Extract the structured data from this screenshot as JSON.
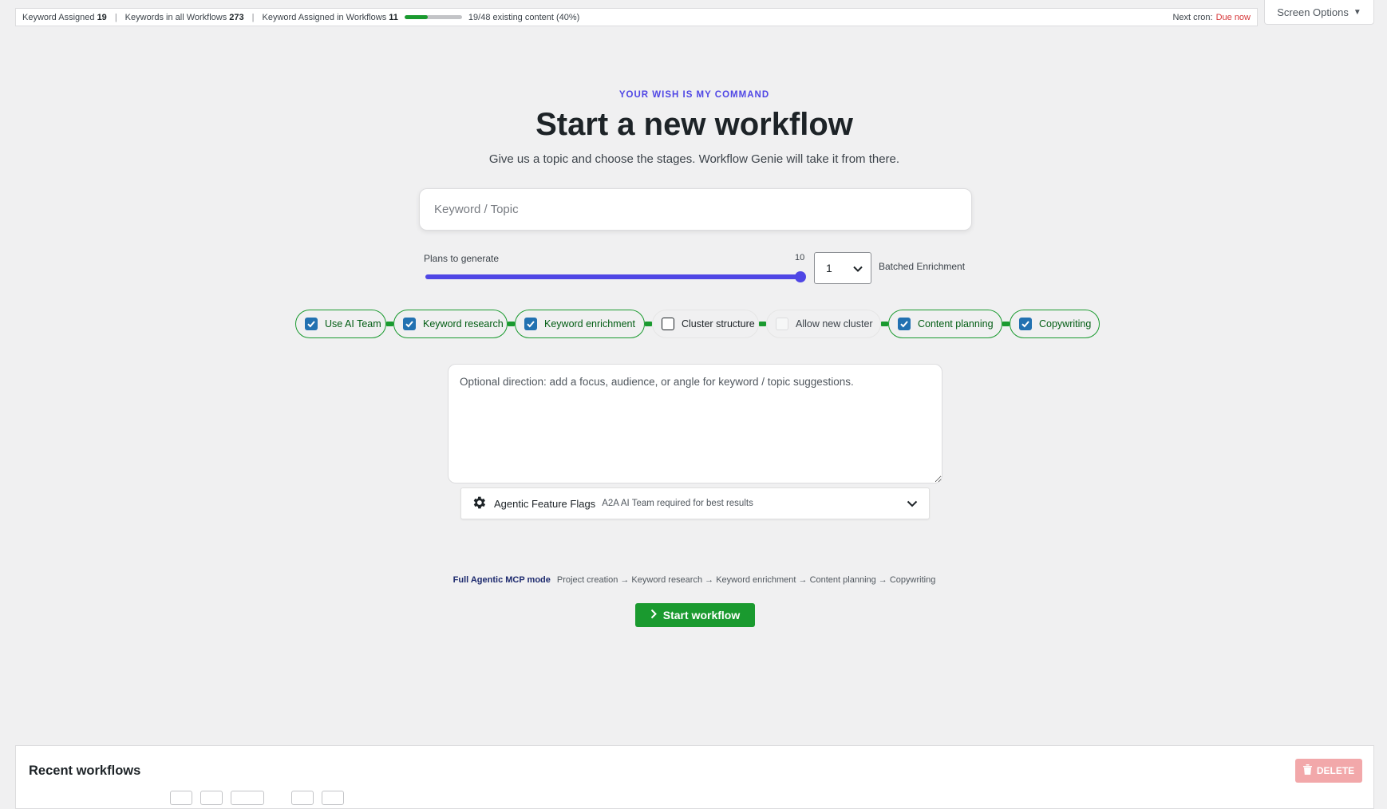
{
  "statusbar": {
    "kw_assigned_label": "Keyword Assigned",
    "kw_assigned_value": "19",
    "kw_all_label": "Keywords in all Workflows",
    "kw_all_value": "273",
    "kw_in_wf_label": "Keyword Assigned in Workflows",
    "kw_in_wf_value": "11",
    "existing_progress": 0.4,
    "existing_text": "19/48 existing content (40%)",
    "cron_label": "Next cron:",
    "cron_value": "Due now",
    "separator": "|"
  },
  "screen_options": {
    "label": "Screen Options",
    "arrow": "▼"
  },
  "hero": {
    "eyebrow": "YOUR WISH IS MY COMMAND",
    "title": "Start a new workflow",
    "subtitle": "Give us a topic and choose the stages. Workflow Genie will take it from there."
  },
  "keyword_input": {
    "placeholder": "Keyword / Topic",
    "value": ""
  },
  "plans": {
    "label": "Plans to generate",
    "max_label": "10",
    "value": 10,
    "min": 1,
    "max": 10
  },
  "batch": {
    "value": "1",
    "label": "Batched Enrichment"
  },
  "stages": [
    {
      "label": "Use AI Team",
      "state": "checked"
    },
    {
      "label": "Keyword research",
      "state": "checked"
    },
    {
      "label": "Keyword enrichment",
      "state": "checked"
    },
    {
      "label": "Cluster structure",
      "state": "unchecked"
    },
    {
      "label": "Allow new cluster",
      "state": "disabled"
    },
    {
      "label": "Content planning",
      "state": "checked"
    },
    {
      "label": "Copywriting",
      "state": "checked"
    }
  ],
  "direction": {
    "placeholder": "Optional direction: add a focus, audience, or angle for keyword / topic suggestions.",
    "value": ""
  },
  "flags": {
    "title": "Agentic Feature Flags",
    "note": "A2A AI Team required for best results"
  },
  "mode": {
    "name": "Full Agentic MCP mode",
    "pipeline": "Project creation → Keyword research → Keyword enrichment → Content planning → Copywriting"
  },
  "start_button": {
    "label": "Start workflow"
  },
  "recent": {
    "title": "Recent workflows",
    "delete_label": "DELETE"
  },
  "colors": {
    "accent": "#4f46e5",
    "success": "#1a9a2f",
    "danger": "#d63638",
    "checkbox": "#2271b1"
  }
}
